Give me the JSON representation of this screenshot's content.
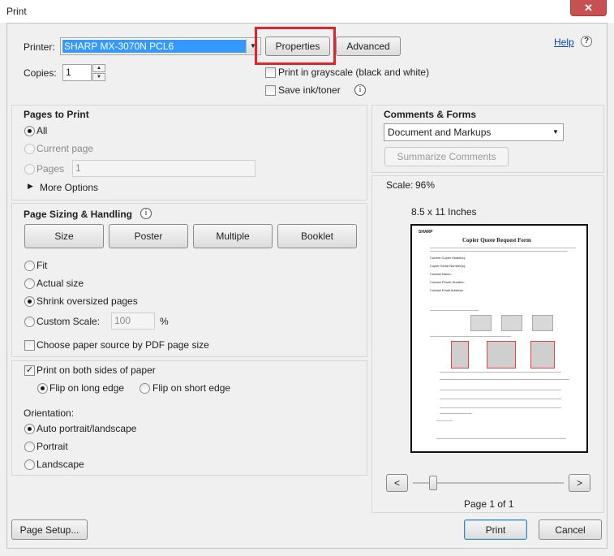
{
  "window": {
    "title": "Print",
    "close_glyph": "✕"
  },
  "printer": {
    "label": "Printer:",
    "selected": "SHARP MX-3070N PCL6",
    "properties_label": "Properties",
    "advanced_label": "Advanced",
    "help_label": "Help",
    "help_glyph": "?",
    "copies_label": "Copies:",
    "copies_value": "1",
    "grayscale_label": "Print in grayscale (black and white)",
    "save_ink_label": "Save ink/toner",
    "info_glyph": "i"
  },
  "pages_to_print": {
    "title": "Pages to Print",
    "all_label": "All",
    "current_page_label": "Current page",
    "pages_label": "Pages",
    "pages_value": "1",
    "more_options_label": "More Options"
  },
  "sizing": {
    "title": "Page Sizing & Handling",
    "size_label": "Size",
    "poster_label": "Poster",
    "multiple_label": "Multiple",
    "booklet_label": "Booklet",
    "fit_label": "Fit",
    "actual_size_label": "Actual size",
    "shrink_label": "Shrink oversized pages",
    "custom_scale_label": "Custom Scale:",
    "custom_scale_value": "100",
    "percent": "%",
    "paper_source_label": "Choose paper source by PDF page size"
  },
  "duplex": {
    "both_sides_label": "Print on both sides of paper",
    "long_edge_label": "Flip on long edge",
    "short_edge_label": "Flip on short edge"
  },
  "orientation": {
    "title": "Orientation:",
    "auto_label": "Auto portrait/landscape",
    "portrait_label": "Portrait",
    "landscape_label": "Landscape"
  },
  "comments_forms": {
    "title": "Comments & Forms",
    "selected": "Document and Markups",
    "summarize_label": "Summarize Comments"
  },
  "preview": {
    "scale_label": "Scale:",
    "scale_value": "96%",
    "paper_size": "8.5 x 11 Inches",
    "page_title": "Copier Quote Request Form",
    "logo_text": "SHARP",
    "prev_glyph": "<",
    "next_glyph": ">",
    "page_indicator": "Page 1 of 1",
    "form_lines": [
      "Current Copier Model(s):",
      "Copier Serial Number(s):",
      "Contact Name:",
      "Contact Phone Number:",
      "Contact Email Address:"
    ]
  },
  "footer": {
    "page_setup_label": "Page Setup...",
    "print_label": "Print",
    "cancel_label": "Cancel"
  }
}
